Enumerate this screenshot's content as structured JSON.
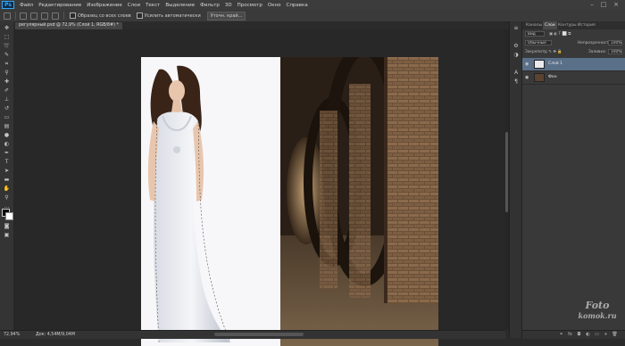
{
  "app": {
    "logo": "Ps",
    "menu": [
      "Файл",
      "Редактирование",
      "Изображение",
      "Слои",
      "Текст",
      "Выделение",
      "Фильтр",
      "3D",
      "Просмотр",
      "Окно",
      "Справка"
    ],
    "window_controls": [
      "–",
      "□",
      "×"
    ]
  },
  "options": {
    "sample_all_layers_label": "Образец со всех слоев",
    "auto_enhance_label": "Усилить автоматически",
    "refine_edge_button": "Уточн. край..."
  },
  "document": {
    "tab_title": "регулярный.psd @ 72,9% (Слой 1, RGB/8#) *"
  },
  "status": {
    "zoom": "72,94%",
    "doc_size": "Док: 4,54M/9,04M"
  },
  "panels": {
    "tabs": [
      "Каналы",
      "Слои",
      "Контуры",
      "История"
    ],
    "active_tab_index": 1,
    "filter_kind": "Вид",
    "blend_mode": "Обычные",
    "opacity_label": "Непрозрачность:",
    "opacity_value": "100%",
    "lock_label": "Закрепить:",
    "fill_label": "Заливка:",
    "fill_value": "100%",
    "layers": [
      {
        "name": "Слой 1",
        "selected": true
      },
      {
        "name": "Фон",
        "selected": false
      }
    ]
  },
  "watermark": {
    "line1": "Foto",
    "line2": "komok.ru"
  },
  "colors": {
    "accent": "#31a8ff",
    "layer_selected": "#5a6f88"
  }
}
